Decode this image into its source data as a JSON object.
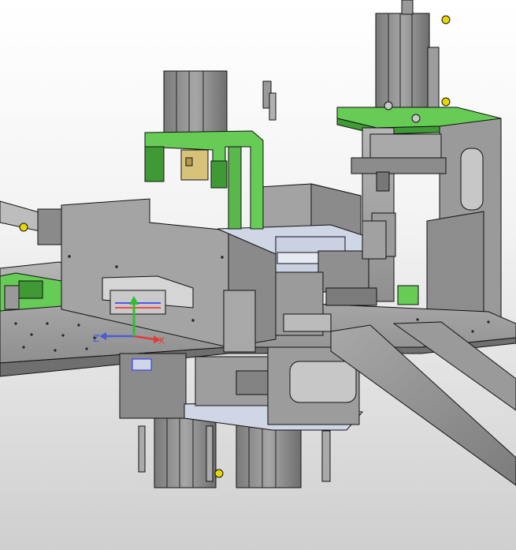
{
  "viewport": {
    "background_top": "#ffffff",
    "background_bottom": "#c8c8c8"
  },
  "colors": {
    "steel": "#8e8e8e",
    "steel_light": "#b9b9b9",
    "steel_dark": "#5a5a5a",
    "edge": "#111111",
    "green": "#66cc55",
    "green_dark": "#3f9a35",
    "blue_plate": "#cfd6e6",
    "brass": "#d8c27a",
    "yellow": "#e8d800"
  },
  "triad": {
    "x_axis_label": "X",
    "z_axis_label": "Z",
    "x_color": "#e23a3a",
    "y_color": "#2fbf2f",
    "z_color": "#4a5bd8",
    "icon": "coordinate-triad-icon"
  },
  "model": {
    "description_icon": "cad-assembly-icon"
  }
}
